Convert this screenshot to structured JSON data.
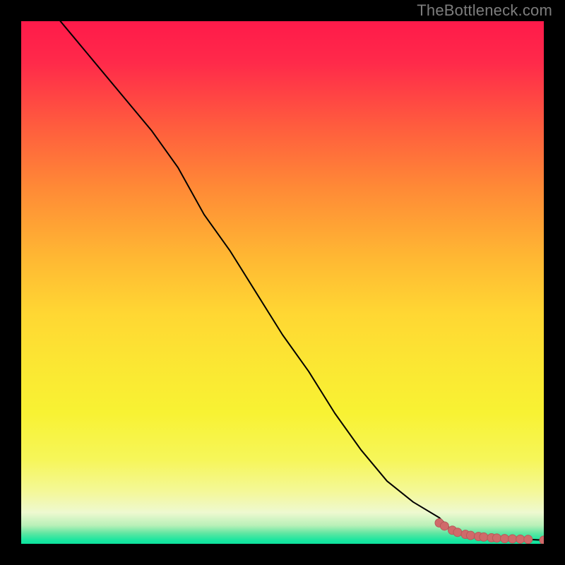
{
  "attribution": "TheBottleneck.com",
  "colors": {
    "line": "#000000",
    "marker_fill": "#d06a6a",
    "marker_stroke": "#b85a5a",
    "background": "#000000"
  },
  "chart_data": {
    "type": "line",
    "title": "",
    "xlabel": "",
    "ylabel": "",
    "xlim": [
      0,
      100
    ],
    "ylim": [
      0,
      100
    ],
    "grid": false,
    "legend": false,
    "series": [
      {
        "name": "curve",
        "x": [
          5,
          10,
          15,
          20,
          25,
          30,
          35,
          40,
          45,
          50,
          55,
          60,
          65,
          70,
          75,
          80,
          82,
          84,
          86,
          88,
          90,
          92,
          94,
          96,
          98,
          100
        ],
        "y": [
          103,
          97,
          91,
          85,
          79,
          72,
          63,
          56,
          48,
          40,
          33,
          25,
          18,
          12,
          8,
          5,
          3,
          2.2,
          1.8,
          1.5,
          1.3,
          1.1,
          1.0,
          0.9,
          0.8,
          0.7
        ]
      }
    ],
    "markers": [
      {
        "x": 80,
        "y": 4.0
      },
      {
        "x": 81,
        "y": 3.4
      },
      {
        "x": 82.5,
        "y": 2.6
      },
      {
        "x": 83.5,
        "y": 2.2
      },
      {
        "x": 85,
        "y": 1.8
      },
      {
        "x": 86,
        "y": 1.6
      },
      {
        "x": 87.5,
        "y": 1.4
      },
      {
        "x": 88.5,
        "y": 1.3
      },
      {
        "x": 90,
        "y": 1.15
      },
      {
        "x": 91,
        "y": 1.1
      },
      {
        "x": 92.5,
        "y": 1.0
      },
      {
        "x": 94,
        "y": 0.95
      },
      {
        "x": 95.5,
        "y": 0.9
      },
      {
        "x": 97,
        "y": 0.85
      },
      {
        "x": 100,
        "y": 0.7
      }
    ]
  }
}
